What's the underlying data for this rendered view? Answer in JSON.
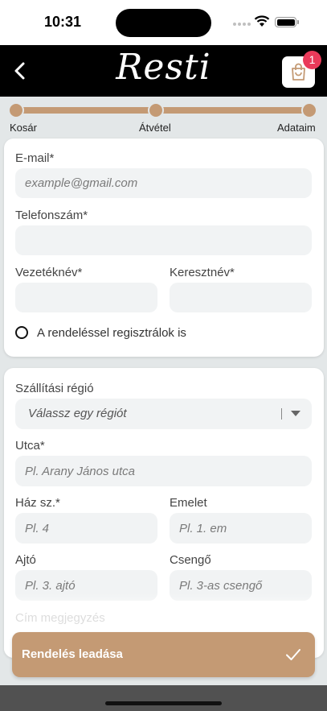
{
  "status_bar": {
    "time": "10:31"
  },
  "header": {
    "logo": "Resti",
    "cart_count": "1"
  },
  "icons": {
    "back": "chevron-left-icon",
    "cart": "shopping-bag-icon",
    "submit": "checkmark-icon"
  },
  "colors": {
    "accent": "#c49a74",
    "badge": "#ea3a5a",
    "header_bg": "#000000"
  },
  "stepper": {
    "steps": [
      "Kosár",
      "Átvétel",
      "Adataim"
    ]
  },
  "contact": {
    "email_label": "E-mail*",
    "email_placeholder": "example@gmail.com",
    "phone_label": "Telefonszám*",
    "lastname_label": "Vezetéknév*",
    "firstname_label": "Keresztnév*",
    "register_label": "A rendeléssel regisztrálok is"
  },
  "address": {
    "region_label": "Szállítási régió",
    "region_placeholder": "Válassz egy régiót",
    "street_label": "Utca*",
    "street_placeholder": "Pl. Arany János utca",
    "house_label": "Ház sz.*",
    "house_placeholder": "Pl. 4",
    "floor_label": "Emelet",
    "floor_placeholder": "Pl. 1. em",
    "door_label": "Ajtó",
    "door_placeholder": "Pl. 3. ajtó",
    "bell_label": "Csengő",
    "bell_placeholder": "Pl. 3-as csengő",
    "note_label": "Cím megjegyzés"
  },
  "submit": {
    "label": "Rendelés leadása"
  }
}
